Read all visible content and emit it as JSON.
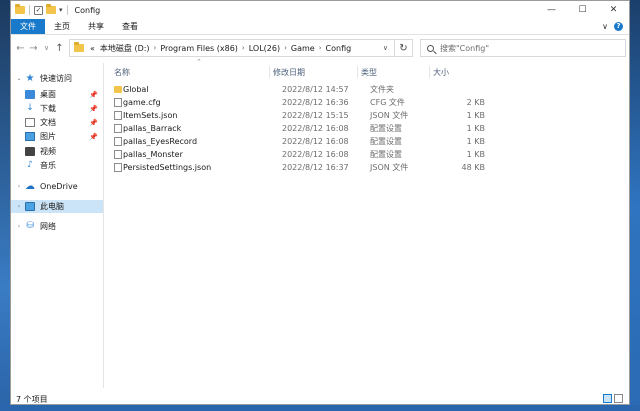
{
  "window": {
    "title": "Config",
    "controls": {
      "minimize": "—",
      "maximize": "☐",
      "close": "✕"
    }
  },
  "ribbon": {
    "tabs": [
      "文件",
      "主页",
      "共享",
      "查看"
    ],
    "expand_glyph": "∨",
    "help_glyph": "?"
  },
  "nav": {
    "back": "←",
    "forward": "→",
    "recent": "∨",
    "up": "↑",
    "breadcrumb": [
      "«",
      "本地磁盘 (D:)",
      "Program Files (x86)",
      "LOL(26)",
      "Game",
      "Config"
    ],
    "refresh": "↻",
    "search_placeholder": "搜索\"Config\""
  },
  "sidebar": {
    "items": [
      {
        "label": "快速访问",
        "icon": "star-icon",
        "pinned": false
      },
      {
        "label": "桌面",
        "icon": "desktop-icon",
        "pinned": true
      },
      {
        "label": "下载",
        "icon": "download-icon",
        "pinned": true
      },
      {
        "label": "文档",
        "icon": "document-icon",
        "pinned": true
      },
      {
        "label": "图片",
        "icon": "pictures-icon",
        "pinned": true
      },
      {
        "label": "视频",
        "icon": "video-icon",
        "pinned": false
      },
      {
        "label": "音乐",
        "icon": "music-icon",
        "pinned": false
      },
      {
        "label": "OneDrive",
        "icon": "cloud-icon",
        "pinned": false
      },
      {
        "label": "此电脑",
        "icon": "pc-icon",
        "pinned": false,
        "selected": true
      },
      {
        "label": "网络",
        "icon": "network-icon",
        "pinned": false
      }
    ]
  },
  "columns": [
    "名称",
    "修改日期",
    "类型",
    "大小"
  ],
  "files": [
    {
      "name": "Global",
      "date": "2022/8/12 14:57",
      "type": "文件夹",
      "size": "",
      "kind": "folder"
    },
    {
      "name": "game.cfg",
      "date": "2022/8/12 16:36",
      "type": "CFG 文件",
      "size": "2 KB",
      "kind": "file"
    },
    {
      "name": "ItemSets.json",
      "date": "2022/8/12 15:15",
      "type": "JSON 文件",
      "size": "1 KB",
      "kind": "file"
    },
    {
      "name": "pallas_Barrack",
      "date": "2022/8/12 16:08",
      "type": "配置设置",
      "size": "1 KB",
      "kind": "file"
    },
    {
      "name": "pallas_EyesRecord",
      "date": "2022/8/12 16:08",
      "type": "配置设置",
      "size": "1 KB",
      "kind": "file"
    },
    {
      "name": "pallas_Monster",
      "date": "2022/8/12 16:08",
      "type": "配置设置",
      "size": "1 KB",
      "kind": "file"
    },
    {
      "name": "PersistedSettings.json",
      "date": "2022/8/12 16:37",
      "type": "JSON 文件",
      "size": "48 KB",
      "kind": "file"
    }
  ],
  "status": {
    "count": "7 个项目"
  },
  "colors": {
    "accent": "#1979ca",
    "selection": "#cce4f7",
    "folder": "#f2c54a"
  }
}
